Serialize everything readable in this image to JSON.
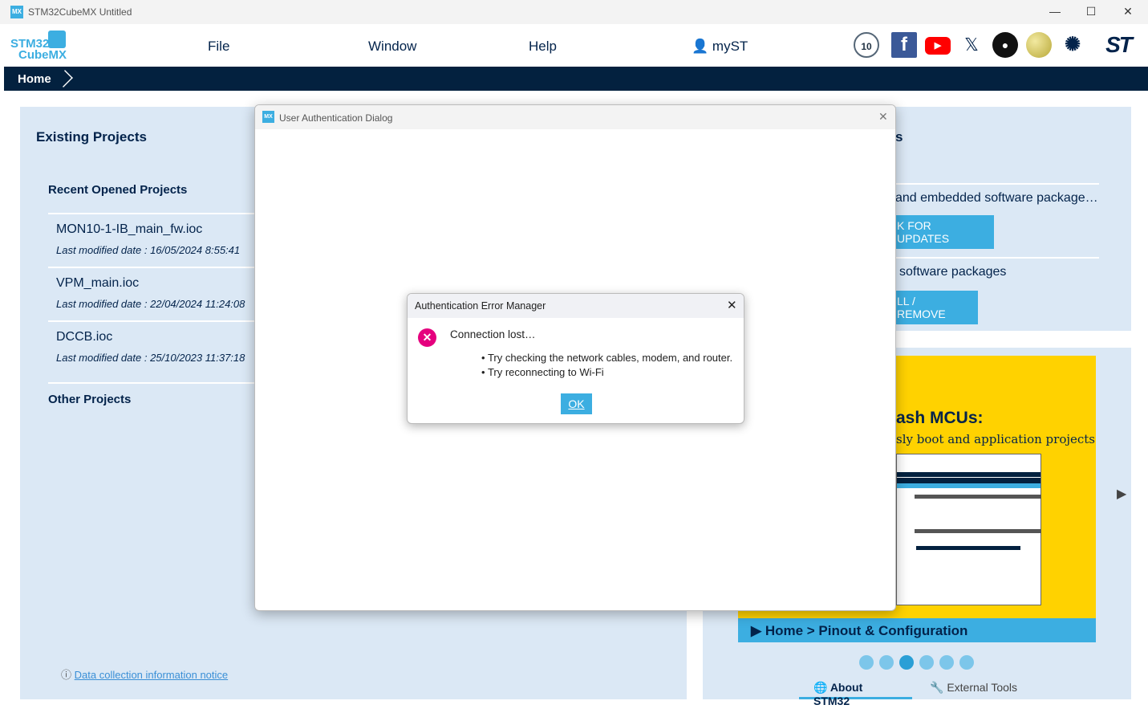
{
  "window": {
    "title": "STM32CubeMX Untitled",
    "app_icon": "MX"
  },
  "header": {
    "logo_line1": "STM32",
    "logo_line2": "CubeMX",
    "menu": [
      "File",
      "Window",
      "Help"
    ],
    "myst": "myST",
    "social_icons": [
      "10-years-icon",
      "facebook-icon",
      "youtube-icon",
      "x-icon",
      "github-icon",
      "wikipedia-icon",
      "network-icon",
      "st-logo-icon"
    ]
  },
  "nav": {
    "home": "Home"
  },
  "left": {
    "title": "Existing Projects",
    "recent_title": "Recent Opened Projects",
    "projects": [
      {
        "name": "MON10-1-IB_main_fw.ioc",
        "date": "Last modified date : 16/05/2024 8:55:41"
      },
      {
        "name": "VPM_main.ioc",
        "date": "Last modified date : 22/04/2024 11:24:08"
      },
      {
        "name": "DCCB.ioc",
        "date": "Last modified date : 25/10/2023 11:37:18"
      }
    ],
    "other_title": "Other Projects",
    "notice": "Data collection information notice"
  },
  "right": {
    "title_partial": "s",
    "row1_text": "and embedded software package…",
    "row1_button": "K FOR UPDATES",
    "row2_text": "software packages",
    "row2_button": "LL / REMOVE"
  },
  "carousel": {
    "headline": "ash MCUs:",
    "subline": "sly boot and application projects",
    "banner": "Home > Pinout & Configuration",
    "dots": 6,
    "active_dot": 2
  },
  "bottom_tabs": [
    "About STM32",
    "External Tools"
  ],
  "modal": {
    "title": "User Authentication Dialog",
    "icon": "MX"
  },
  "error_dialog": {
    "title": "Authentication Error Manager",
    "message": "Connection lost…",
    "bullets": [
      "Try checking the network cables, modem, and router.",
      "Try reconnecting to Wi-Fi"
    ],
    "ok": "OK"
  },
  "colors": {
    "navy": "#03213f",
    "accent": "#3caee1",
    "panel": "#dbe8f5",
    "yellow": "#ffd200",
    "error": "#e5007e"
  }
}
